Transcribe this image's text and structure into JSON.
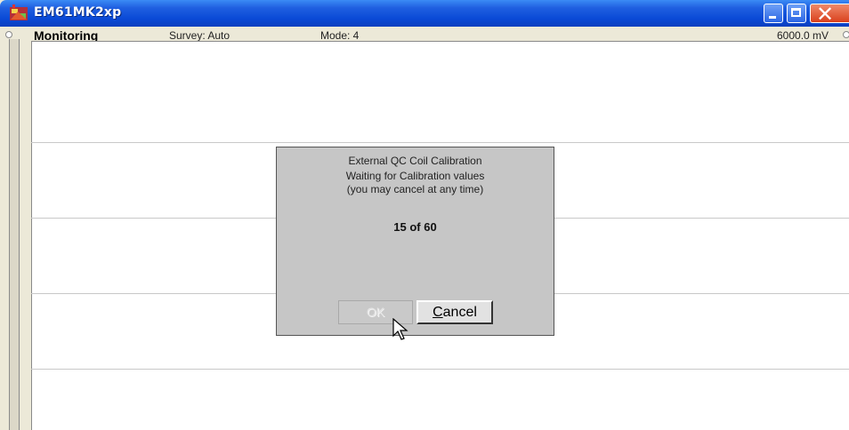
{
  "window": {
    "title": "EM61MK2xp",
    "controls": [
      "minimize",
      "maximize",
      "close"
    ]
  },
  "status_bar": {
    "panel_label": "Monitoring",
    "survey": "Survey: Auto",
    "mode": "Mode: 4",
    "scale": "6000.0 mV"
  },
  "dialog": {
    "title": "External QC Coil Calibration",
    "message_line1": "Waiting for Calibration values",
    "message_line2": "(you may cancel at any time)",
    "progress_text": "15 of 60",
    "progress": {
      "current": 15,
      "total": 60
    },
    "ok_label": "OK",
    "cancel_label_accel": "C",
    "cancel_label_rest": "ancel"
  },
  "icons": {
    "app": "em61-app-icon",
    "cursor": "mouse-pointer-icon"
  },
  "colors": {
    "titlebar": "#0a4ad6",
    "close_button": "#d9401c",
    "dialog_bg": "#c6c6c6",
    "plot_bg": "#ffffff"
  }
}
